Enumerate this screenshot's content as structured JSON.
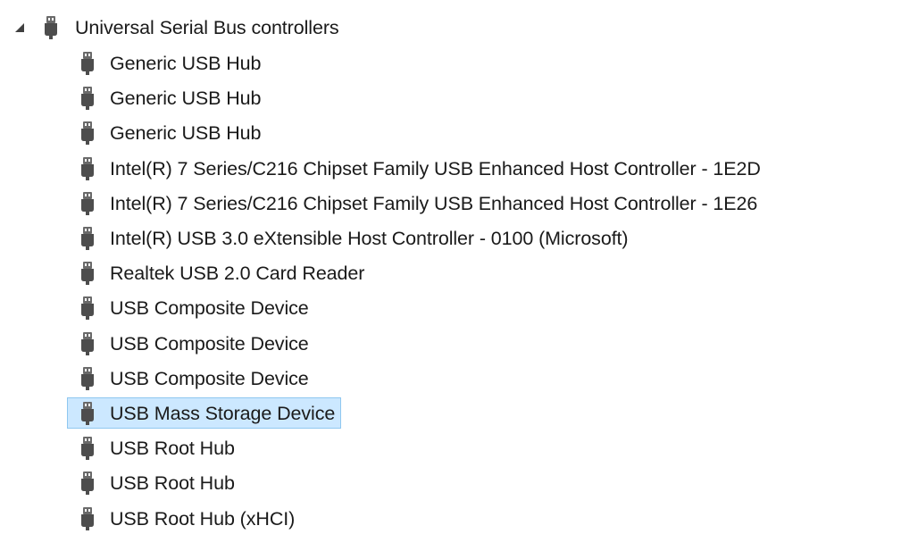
{
  "category": {
    "label": "Universal Serial Bus controllers",
    "expander_icon": "collapse-triangle-icon",
    "icon": "usb-plug-icon"
  },
  "devices": [
    {
      "label": "Generic USB Hub",
      "selected": false
    },
    {
      "label": "Generic USB Hub",
      "selected": false
    },
    {
      "label": "Generic USB Hub",
      "selected": false
    },
    {
      "label": "Intel(R) 7 Series/C216 Chipset Family USB Enhanced Host Controller - 1E2D",
      "selected": false
    },
    {
      "label": "Intel(R) 7 Series/C216 Chipset Family USB Enhanced Host Controller - 1E26",
      "selected": false
    },
    {
      "label": "Intel(R) USB 3.0 eXtensible Host Controller - 0100 (Microsoft)",
      "selected": false
    },
    {
      "label": "Realtek USB 2.0 Card Reader",
      "selected": false
    },
    {
      "label": "USB Composite Device",
      "selected": false
    },
    {
      "label": "USB Composite Device",
      "selected": false
    },
    {
      "label": "USB Composite Device",
      "selected": false
    },
    {
      "label": "USB Mass Storage Device",
      "selected": true
    },
    {
      "label": "USB Root Hub",
      "selected": false
    },
    {
      "label": "USB Root Hub",
      "selected": false
    },
    {
      "label": "USB Root Hub (xHCI)",
      "selected": false
    }
  ],
  "colors": {
    "selection_fill": "#cce8ff",
    "selection_border": "#8fc7f0",
    "icon_dark": "#4d4d4d",
    "text": "#1a1a1a"
  }
}
